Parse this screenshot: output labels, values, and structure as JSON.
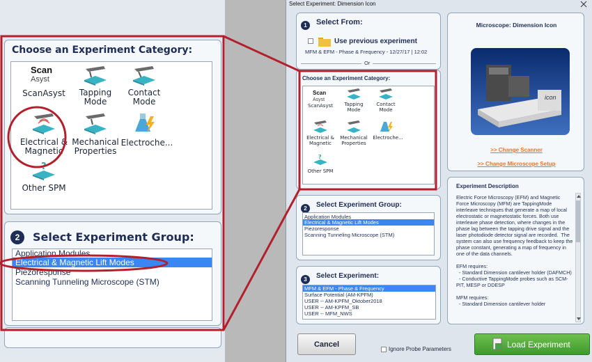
{
  "zoom": {
    "category_title": "Choose an Experiment Category:",
    "categories": [
      {
        "label": "ScanAsyst",
        "icon": "scanasyst-logo-icon"
      },
      {
        "label": "Tapping\nMode",
        "icon": "tapping-mode-icon"
      },
      {
        "label": "Contact\nMode",
        "icon": "contact-mode-icon"
      },
      {
        "label": "Electrical &\nMagnetic",
        "icon": "electrical-magnetic-icon"
      },
      {
        "label": "Mechanical\nProperties",
        "icon": "mechanical-properties-icon"
      },
      {
        "label": "Electroche...",
        "icon": "electrochemistry-flask-icon"
      },
      {
        "label": "Other SPM",
        "icon": "other-spm-icon"
      }
    ],
    "scanasyst_logo": {
      "line1": "Scan",
      "line2": "Asyst"
    },
    "group_step": "2",
    "group_title": "Select Experiment Group:",
    "groups": [
      "Application Modules",
      "Electrical & Magnetic Lift Modes",
      "Piezoresponse",
      "Scanning Tunneling Microscope (STM)"
    ],
    "selected_group": 1
  },
  "dialog": {
    "title": "Select Experiment: Dimension Icon",
    "step1": "1",
    "select_from": "Select From:",
    "use_previous": "Use previous experiment",
    "previous_name": "MFM & EFM - Phase & Frequency - 12/27/17 | 12:02",
    "or": "Or",
    "category_title": "Choose an Experiment Category:",
    "step2": "2",
    "group_title": "Select Experiment Group:",
    "step3": "3",
    "experiment_title": "Select Experiment:",
    "experiments": [
      "MFM & EFM - Phase & Frequency",
      "Surface Potential (AM-KPFM)",
      "USER -- AM-KPFM_Oktober2018",
      "USER -- AM-KPFM_SB",
      "USER -- MFM_NWS"
    ],
    "selected_experiment": 0,
    "microscope_title": "Microscope: Dimension Icon",
    "microscope_logo": "icon",
    "change_scanner": ">> Change Scanner",
    "change_microscope": ">> Change Microscope Setup",
    "desc_title": "Experiment Description",
    "description": "Electric Force Microscopy (EFM) and Magnetic Force Microscopy (MFM) are TappingMode interleave techniques that generate a map of local electrostatic or magnetostatic forces. Both use interleave phase detection, where changes in the phase lag between the tapping drive signal and the laser photodiode detector signal are recorded.  The system can also use frequency feedback to keep the phase constant, generating a map of frequency in one of the data channels.\n\nEFM requires:\n  - Standard Dimension cantilever holder (DAFMCH)\n  - Conductive TappingMode probes such as SCM-PIT, MESP or DDESP\n\nMFM requires:\n  - Standard Dimension cantilever holder",
    "cancel": "Cancel",
    "ignore_probe": "Ignore Probe Parameters",
    "load": "Load Experiment"
  },
  "colors": {
    "annotation": "#b2202e",
    "selection": "#3a86f2",
    "load_button": "#3f9a2e"
  }
}
